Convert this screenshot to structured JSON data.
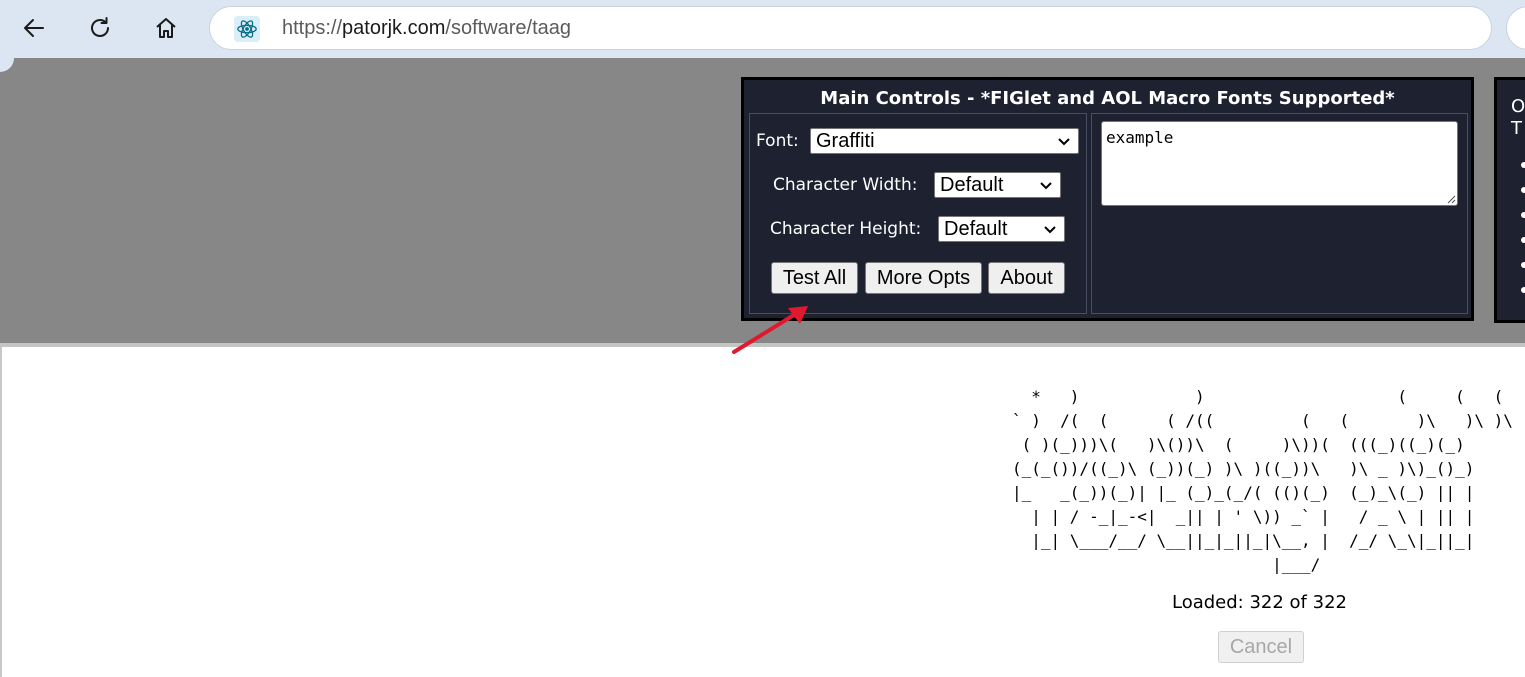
{
  "browser": {
    "back_icon": "back-arrow-icon",
    "reload_icon": "reload-icon",
    "home_icon": "home-icon",
    "site_icon": "react-atom-icon",
    "url_prefix": "https://",
    "url_host": "patorjk.com",
    "url_path": "/software/taag"
  },
  "controls": {
    "title": "Main Controls - *FIGlet and AOL Macro Fonts Supported*",
    "font_label": "Font:",
    "font_value": "Graffiti",
    "width_label": "Character Width:",
    "width_value": "Default",
    "height_label": "Character Height:",
    "height_value": "Default",
    "test_all_label": "Test All",
    "more_opts_label": "More Opts",
    "about_label": "About",
    "input_text": "example"
  },
  "side_panel": {
    "line1": "O",
    "line2": "T",
    "bullet_count": 6
  },
  "annotation": {
    "arrow_color": "#e0192f",
    "points_to": "Test All"
  },
  "output": {
    "ascii_art": "  *   )            )                    (     (   (\n` )  /(  (      ( /((         (   (       )\\   )\\ )\\\n ( )(_)))\\(   )\\())\\  (     )\\))(  (((_)((_)(_)\n(_(_())/((_)\\ (_))(_) )\\ )((_))\\   )\\ _ )\\)_()_)\n|_   _(_))(_)| |_ (_)_(_/( (()(_)  (_)_\\(_) || |\n  | | / -_|_-<|  _|| | ' \\)) _` |   / _ \\ | || |\n  |_| \\___/__/ \\__||_|_||_|\\__, |  /_/ \\_\\|_||_|\n                           |___/",
    "loaded_text": "Loaded: 322 of 322",
    "cancel_label": "Cancel"
  },
  "colors": {
    "toolbar": "#dbe6f2",
    "header_band": "#878787",
    "controls_bg": "#1e2130"
  }
}
